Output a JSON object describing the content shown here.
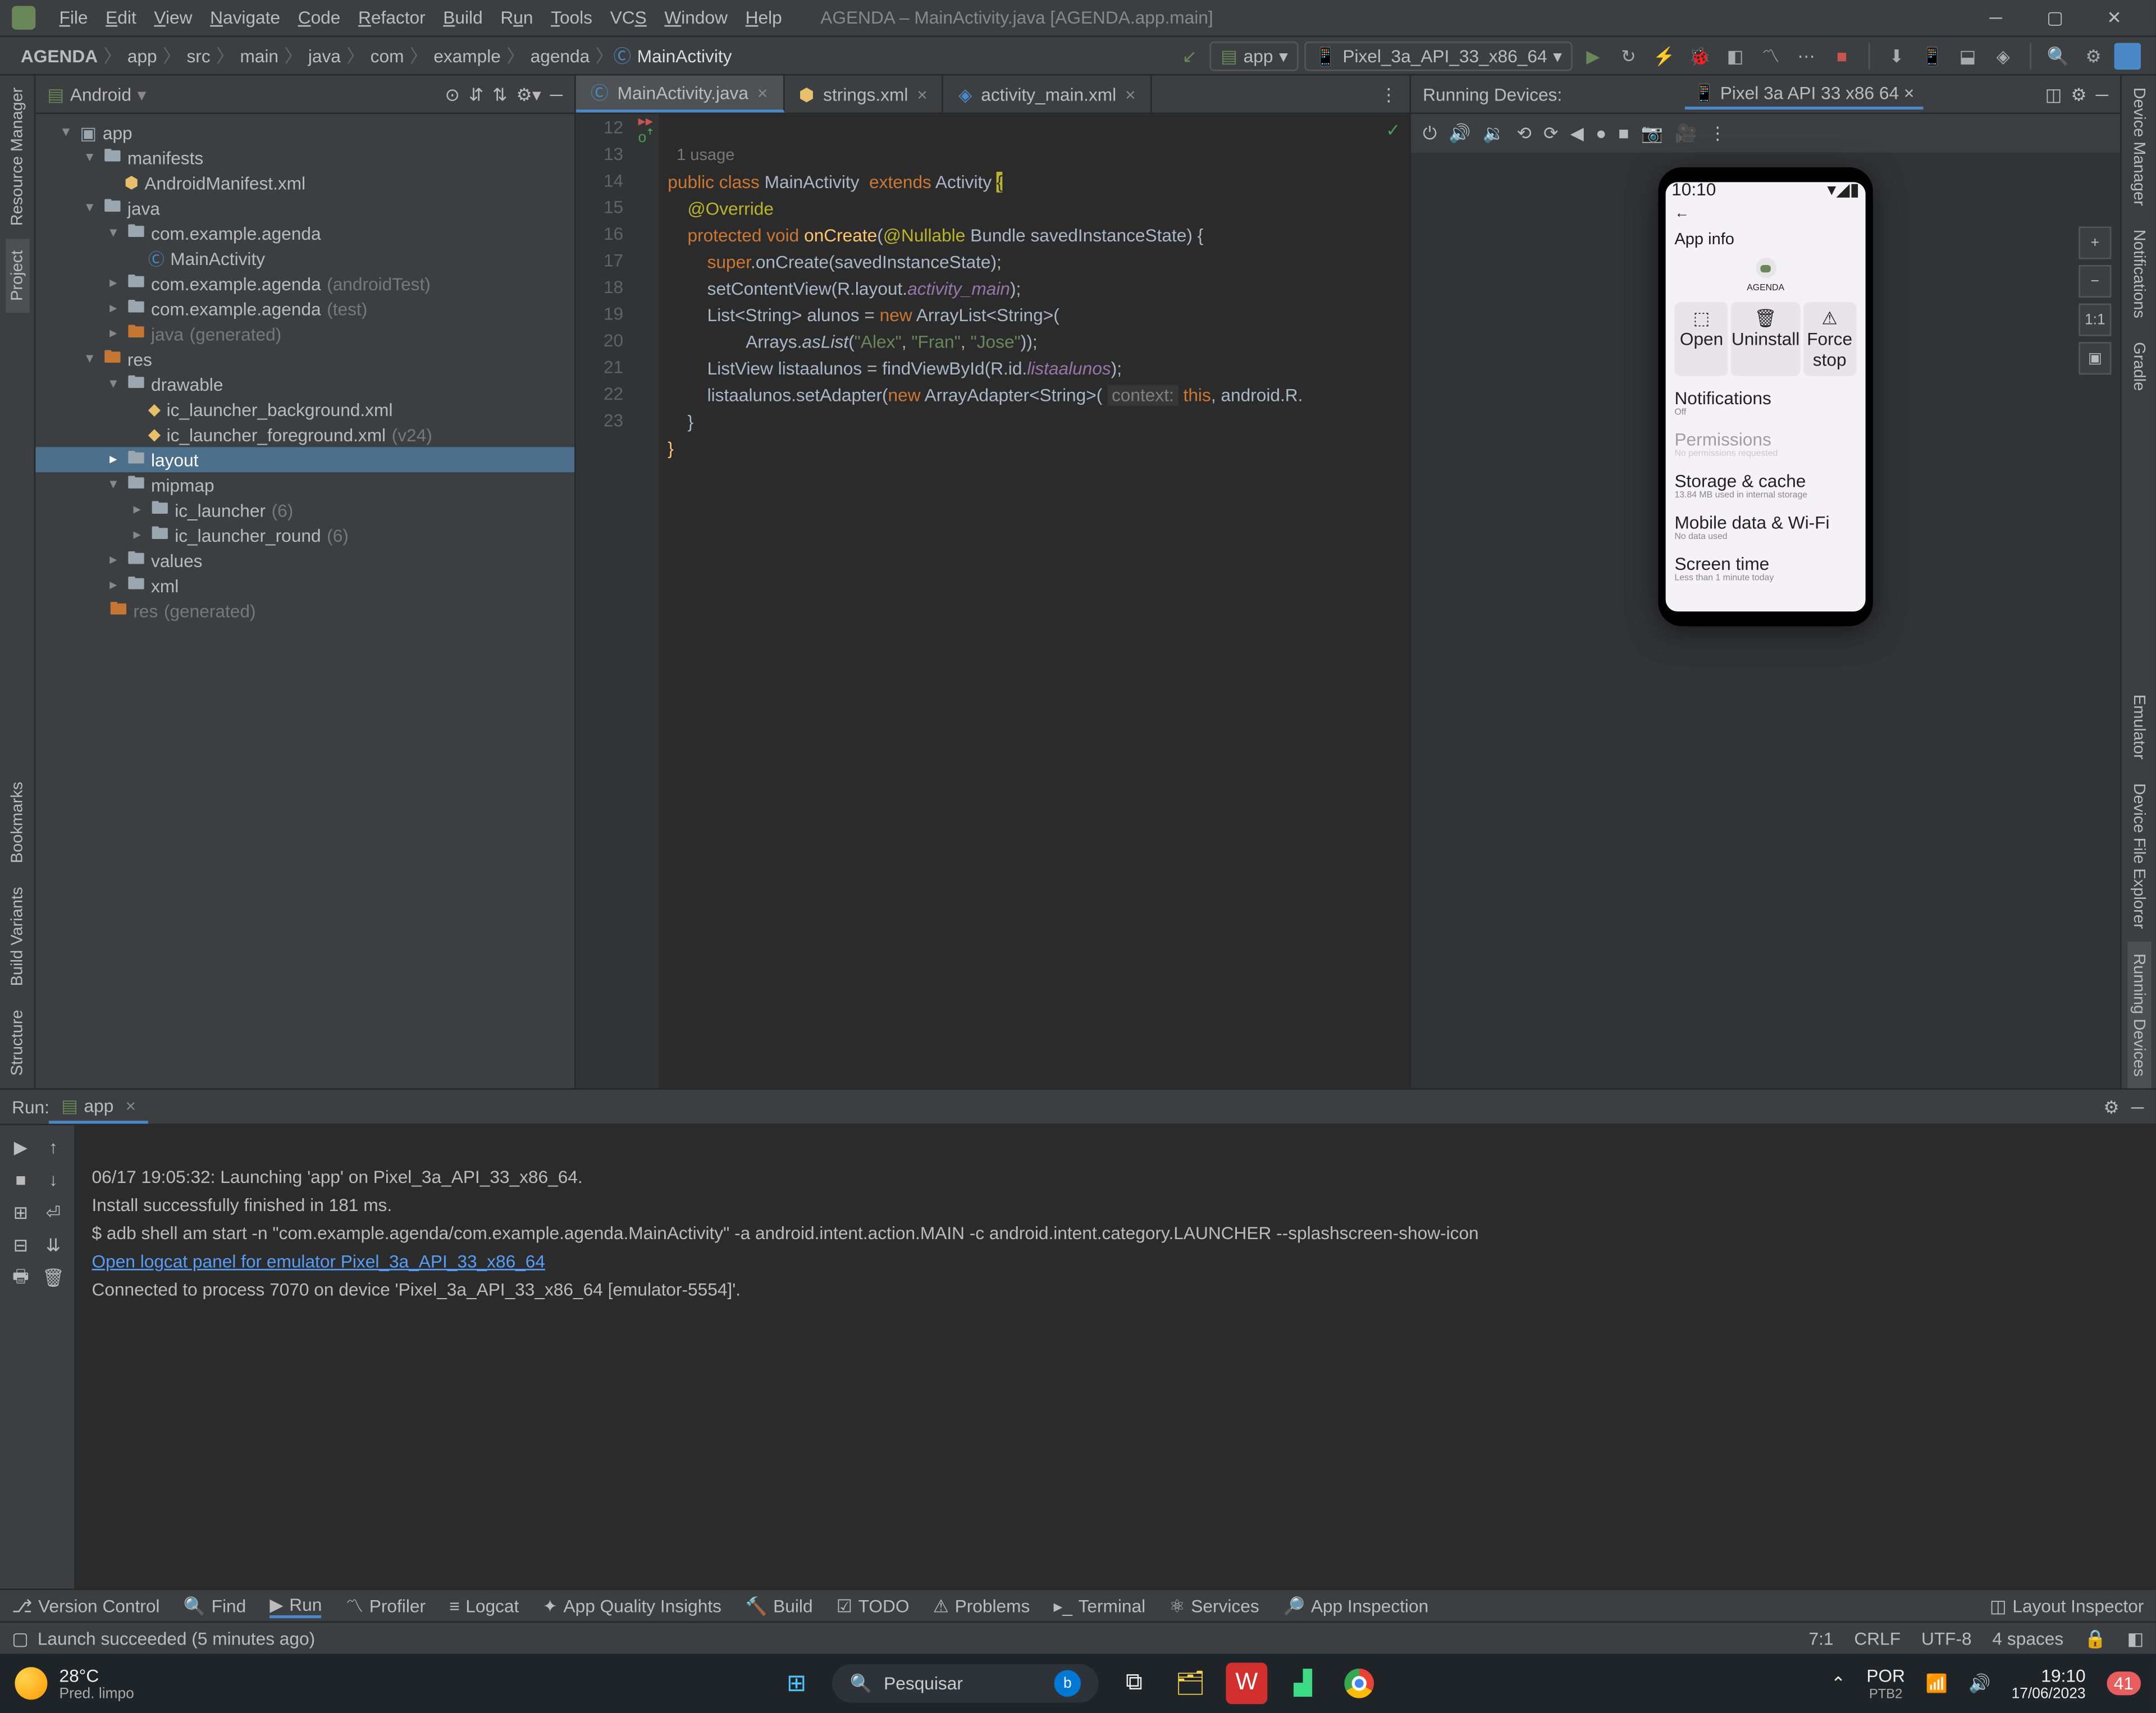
{
  "window": {
    "title": "AGENDA – MainActivity.java [AGENDA.app.main]"
  },
  "menu": {
    "file": "File",
    "edit": "Edit",
    "view": "View",
    "navigate": "Navigate",
    "code": "Code",
    "refactor": "Refactor",
    "build": "Build",
    "run": "Run",
    "tools": "Tools",
    "vcs": "VCS",
    "window": "Window",
    "help": "Help"
  },
  "breadcrumbs": [
    "AGENDA",
    "app",
    "src",
    "main",
    "java",
    "com",
    "example",
    "agenda",
    "MainActivity"
  ],
  "toolbar": {
    "app_config": "app",
    "device": "Pixel_3a_API_33_x86_64"
  },
  "left_tabs": {
    "project": "Project",
    "resource": "Resource Manager",
    "bookmarks": "Bookmarks",
    "variants": "Build Variants",
    "structure": "Structure"
  },
  "right_tabs": {
    "notifications": "Notifications",
    "gradle": "Gradle",
    "dev_mgr": "Device Manager",
    "emulator": "Emulator",
    "dfe": "Device File Explorer",
    "rd": "Running Devices"
  },
  "project": {
    "header": "Android",
    "root": "app",
    "manifests": "manifests",
    "manifest_file": "AndroidManifest.xml",
    "java": "java",
    "pkg": "com.example.agenda",
    "mainactivity": "MainActivity",
    "pkg_at": "com.example.agenda",
    "pkg_at_s": "(androidTest)",
    "pkg_t": "com.example.agenda",
    "pkg_t_s": "(test)",
    "java_gen": "java",
    "java_gen_s": "(generated)",
    "res": "res",
    "drawable": "drawable",
    "ic_bg": "ic_launcher_background.xml",
    "ic_fg": "ic_launcher_foreground.xml",
    "ic_fg_s": "(v24)",
    "layout": "layout",
    "mipmap": "mipmap",
    "ic_l": "ic_launcher",
    "ic_l_s": "(6)",
    "ic_lr": "ic_launcher_round",
    "ic_lr_s": "(6)",
    "values": "values",
    "xml": "xml",
    "res_gen": "res",
    "res_gen_s": "(generated)"
  },
  "tabs": {
    "t1": "MainActivity.java",
    "t2": "strings.xml",
    "t3": "activity_main.xml"
  },
  "editor": {
    "usage": "1 usage",
    "lines": [
      "12",
      "13",
      "14",
      "15",
      "16",
      "17",
      "18",
      "19",
      "20",
      "21",
      "22",
      "23"
    ]
  },
  "emulator": {
    "header_label": "Running Devices:",
    "device_tab": "Pixel 3a API 33 x86 64",
    "time": "10:10",
    "app_info": "App info",
    "app_name": "AGENDA",
    "open": "Open",
    "uninstall": "Uninstall",
    "force": "Force stop",
    "notif": "Notifications",
    "notif_s": "Off",
    "perm": "Permissions",
    "perm_s": "No permissions requested",
    "storage": "Storage & cache",
    "storage_s": "13.84 MB used in internal storage",
    "mobile": "Mobile data & Wi-Fi",
    "mobile_s": "No data used",
    "screen": "Screen time",
    "screen_s": "Less than 1 minute today"
  },
  "run": {
    "label": "Run:",
    "tab": "app",
    "line1": "06/17 19:05:32: Launching 'app' on Pixel_3a_API_33_x86_64.",
    "line2": "Install successfully finished in 181 ms.",
    "line3": "$ adb shell am start -n \"com.example.agenda/com.example.agenda.MainActivity\" -a android.intent.action.MAIN -c android.intent.category.LAUNCHER --splashscreen-show-icon",
    "line4": "Open logcat panel for emulator Pixel_3a_API_33_x86_64",
    "line5": "Connected to process 7070 on device 'Pixel_3a_API_33_x86_64 [emulator-5554]'."
  },
  "bottom": {
    "vc": "Version Control",
    "find": "Find",
    "run": "Run",
    "profiler": "Profiler",
    "logcat": "Logcat",
    "aqi": "App Quality Insights",
    "build": "Build",
    "todo": "TODO",
    "problems": "Problems",
    "terminal": "Terminal",
    "services": "Services",
    "inspection": "App Inspection",
    "layout_inspector": "Layout Inspector"
  },
  "status": {
    "msg": "Launch succeeded (5 minutes ago)",
    "pos": "7:1",
    "le": "CRLF",
    "enc": "UTF-8",
    "indent": "4 spaces"
  },
  "taskbar": {
    "temp": "28°C",
    "weather": "Pred. limpo",
    "search_ph": "Pesquisar",
    "lang1": "POR",
    "lang2": "PTB2",
    "time": "19:10",
    "date": "17/06/2023",
    "notif_count": "41"
  }
}
